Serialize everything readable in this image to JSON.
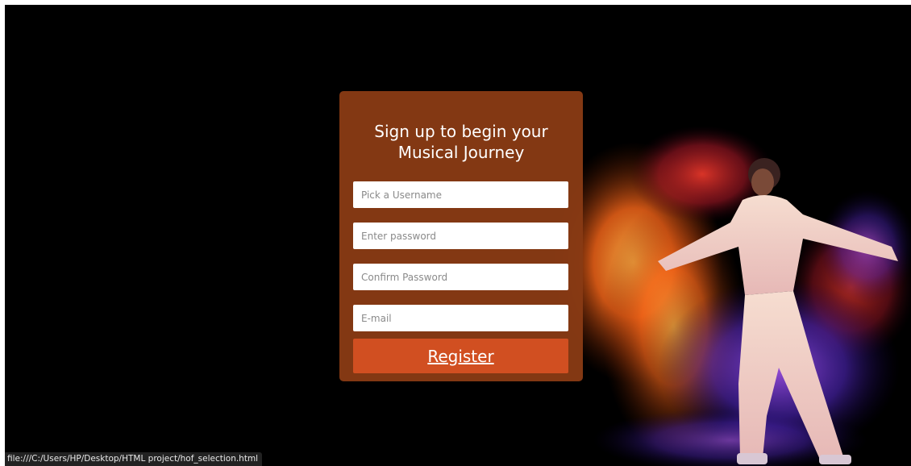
{
  "form": {
    "title_line1": "Sign up to begin your",
    "title_line2": "Musical Journey",
    "username_placeholder": "Pick a Username",
    "password_placeholder": "Enter password",
    "confirm_password_placeholder": "Confirm Password",
    "email_placeholder": "E-mail",
    "register_label": "Register"
  },
  "status_bar": {
    "url": "file:///C:/Users/HP/Desktop/HTML project/hof_selection.html"
  },
  "colors": {
    "page_background": "#000000",
    "card_background": "#883a14",
    "button_background": "#d14f21",
    "text": "#ffffff"
  },
  "images": {
    "hero": "dancer-light-trails-image"
  }
}
